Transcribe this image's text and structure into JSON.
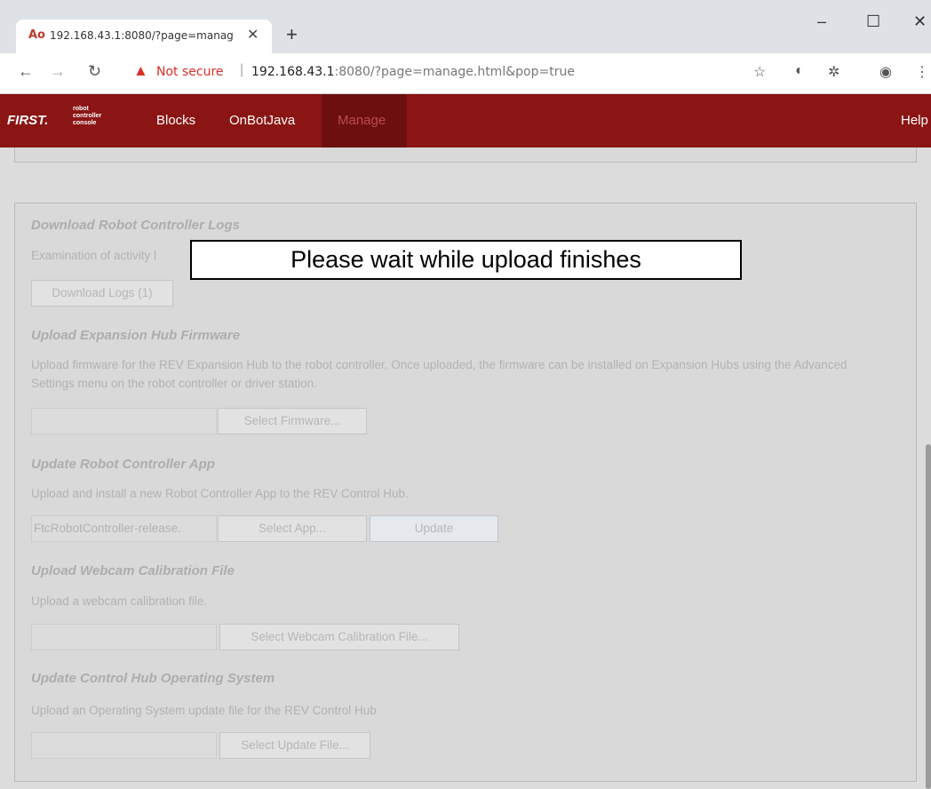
{
  "browser": {
    "tab_title": "192.168.43.1:8080/?page=manag",
    "tab_icon": "Ao",
    "not_secure": "Not secure",
    "url_host": "192.168.43.1",
    "url_rest": ":8080/?page=manage.html&pop=true"
  },
  "app": {
    "logo_first": "FIRST.",
    "logo_sub": "robot controller console",
    "nav": [
      "Blocks",
      "OnBotJava",
      "Manage"
    ],
    "help": "Help"
  },
  "overlay": "Please wait while upload finishes",
  "sections": {
    "logs": {
      "title": "Download Robot Controller Logs",
      "desc": "Examination of activity l",
      "button": "Download Logs (1)"
    },
    "firmware": {
      "title": "Upload Expansion Hub Firmware",
      "desc": "Upload firmware for the REV Expansion Hub to the robot controller. Once uploaded, the firmware can be installed on Expansion Hubs using the Advanced Settings menu on the robot controller or driver station.",
      "button": "Select Firmware..."
    },
    "app_update": {
      "title": "Update Robot Controller App",
      "desc": "Upload and install a new Robot Controller App to the REV Control Hub.",
      "field": "FtcRobotController-release.",
      "select_button": "Select App...",
      "update_button": "Update"
    },
    "webcam": {
      "title": "Upload Webcam Calibration File",
      "desc": "Upload a webcam calibration file.",
      "button": "Select Webcam Calibration File..."
    },
    "os": {
      "title": "Update Control Hub Operating System",
      "desc": "Upload an Operating System update file for the REV Control Hub",
      "button": "Select Update File..."
    }
  }
}
